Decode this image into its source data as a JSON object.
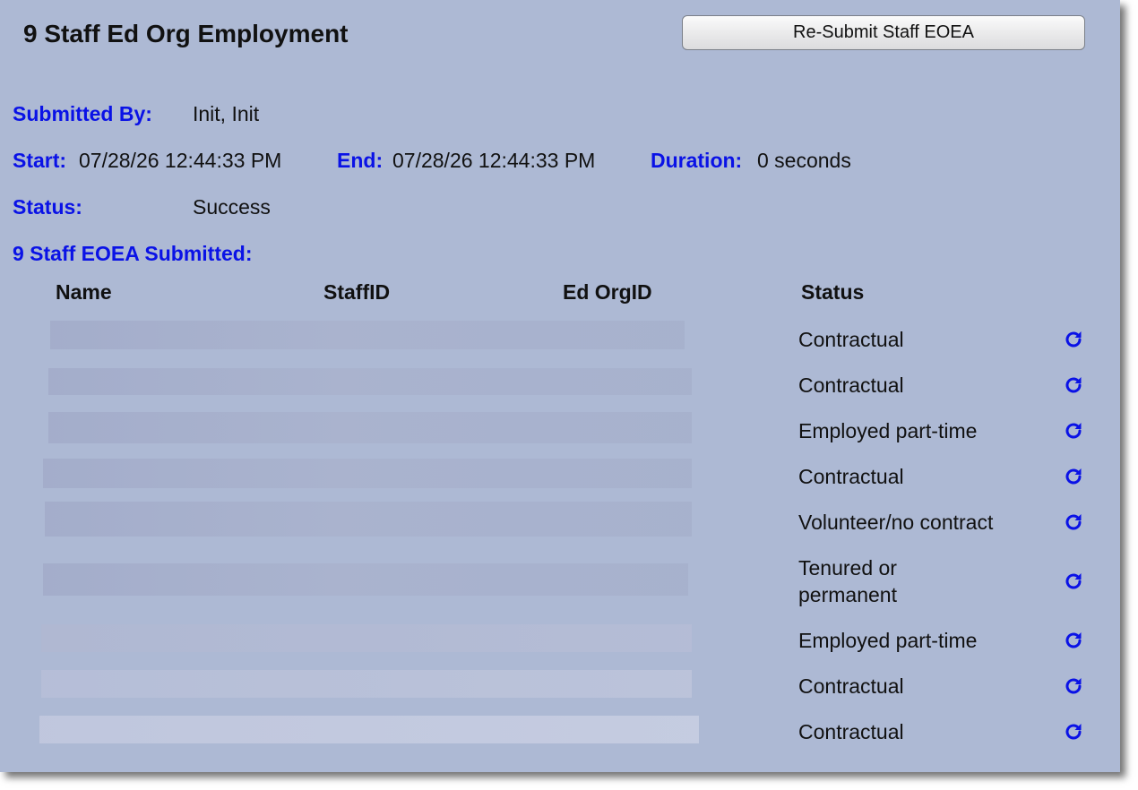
{
  "header": {
    "title": "9 Staff Ed Org Employment",
    "resubmit_label": "Re-Submit Staff EOEA"
  },
  "summary": {
    "submitted_by_label": "Submitted By:",
    "submitted_by_value": "Init, Init",
    "start_label": "Start:",
    "start_value": "07/28/26 12:44:33 PM",
    "end_label": "End:",
    "end_value": "07/28/26 12:44:33 PM",
    "duration_label": "Duration:",
    "duration_value": "0 seconds",
    "status_label": "Status:",
    "status_value": "Success",
    "submitted_count_label": "9 Staff EOEA Submitted:"
  },
  "table": {
    "columns": [
      "Name",
      "StaffID",
      "Ed OrgID",
      "Status"
    ],
    "rows": [
      {
        "status": "Contractual",
        "action_icon": "refresh-icon"
      },
      {
        "status": "Contractual",
        "action_icon": "refresh-icon"
      },
      {
        "status": "Employed part-time",
        "action_icon": "refresh-icon"
      },
      {
        "status": "Contractual",
        "action_icon": "refresh-icon"
      },
      {
        "status": "Volunteer/no contract",
        "action_icon": "refresh-icon"
      },
      {
        "status": "Tenured or permanent",
        "action_icon": "refresh-icon"
      },
      {
        "status": "Employed part-time",
        "action_icon": "refresh-icon"
      },
      {
        "status": "Contractual",
        "action_icon": "refresh-icon"
      },
      {
        "status": "Contractual",
        "action_icon": "refresh-icon"
      }
    ]
  },
  "colors": {
    "panel_background": "#adb9d4",
    "label_blue": "#0a12e6",
    "icon_blue": "#0a12e6"
  }
}
